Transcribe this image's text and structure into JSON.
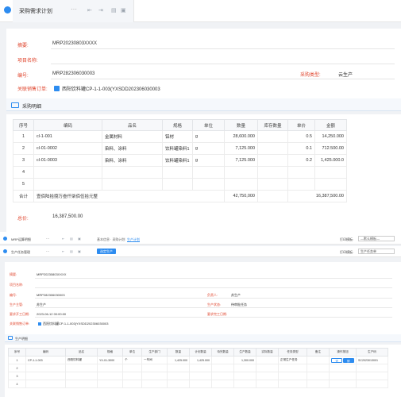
{
  "win1": {
    "tab_title": "采购需求计划",
    "tab_more": "···",
    "form": {
      "summary_label": "摘要:",
      "summary_value": "MRP20230803XXXX",
      "project_label": "项目名称:",
      "code_label": "编号:",
      "code_value": "MRP282306030003",
      "purchase_type_label": "采购类型:",
      "purchase_type_value": "云生产",
      "related_order_label": "关联销售订单:",
      "related_order_value": "西阳饮料罐CP-1-1-003(YXSDD202306030003"
    },
    "section_title": "采购明细",
    "table": {
      "headers": [
        "序号",
        "编码",
        "品名",
        "规格",
        "单位",
        "数量",
        "库存数量",
        "单价",
        "金额"
      ],
      "rows": [
        {
          "no": "1",
          "code": "cl-1-001",
          "name": "金属材料",
          "spec": "铝材",
          "unit": "g",
          "qty": "28,600.000",
          "stock": "",
          "price": "0.5",
          "amount": "14,250.000"
        },
        {
          "no": "2",
          "code": "cl-01-0002",
          "name": "染料、涂料",
          "spec": "饮料罐染料1",
          "unit": "g",
          "qty": "7,125.000",
          "stock": "",
          "price": "0.1",
          "amount": "712.500.00"
        },
        {
          "no": "3",
          "code": "cl-01-0003",
          "name": "染料、涂料",
          "spec": "饮料罐染料1",
          "unit": "g",
          "qty": "7,125.000",
          "stock": "",
          "price": "0.2",
          "amount": "1,425.000.0"
        },
        {
          "no": "4",
          "code": "",
          "name": "",
          "spec": "",
          "unit": "",
          "qty": "",
          "stock": "",
          "price": "",
          "amount": ""
        },
        {
          "no": "5",
          "code": "",
          "name": "",
          "spec": "",
          "unit": "",
          "qty": "",
          "stock": "",
          "price": "",
          "amount": ""
        }
      ],
      "total_label": "合计",
      "total_words": "壹佰陆拾捌万叁仟柒佰伍拾元整",
      "total_qty": "42,750,000",
      "total_amount": "16,387,500.00"
    },
    "total_label": "总价:",
    "total_value": "16,387,500.00"
  },
  "win2": {
    "top_title": "MRP运算明细",
    "top_more": "···",
    "top_info1": "基本信息 · 采购计划",
    "top_link": "生产计划",
    "top_right_label": "打印模板:",
    "top_right_value": "—默认模板—",
    "sub_title": "生产任务管理",
    "sub_more": "···",
    "sub_button": "选定生产",
    "sub_right_label": "打印模板:",
    "sub_right_value": "生产任务单",
    "form": {
      "summary_label": "摘要:",
      "summary_value": "MRP20230803XXXX",
      "project_label": "项目名称:",
      "code_label": "编号:",
      "code_value": "MRP282306030003",
      "owner_label": "负责人:",
      "owner_value": "苏生产",
      "produce_label": "生产主管:",
      "produce_value": "苏生产",
      "status_label": "生产状态:",
      "status_value": "待审批任务",
      "start_label": "要求开工日期:",
      "start_value": "2023-06-12 00:00:00",
      "finish_label": "要求完工日期:",
      "related_label": "关联销售订单:",
      "related_value": "西阳饮料罐CP-1-1-003(YXSDD202306030003"
    },
    "section_title": "生产明细",
    "table": {
      "headers": [
        "序号",
        "编码",
        "品名",
        "规格",
        "单位",
        "生产部门",
        "数量",
        "计划数量",
        "待完数量",
        "生产数量",
        "实际数量",
        "任务类型",
        "备注",
        "操作按钮",
        "生产码"
      ],
      "rows": [
        {
          "no": "1",
          "code": "CP-1-1-003",
          "name": "西阳饮料罐",
          "spec": "YX-01-3000",
          "unit": "个",
          "dept": "一车间",
          "qty": "1,425.000",
          "plan": "1,425.000",
          "pending": "",
          "produce": "1,300.000",
          "actual": "",
          "type": "正常生产任务",
          "note": "",
          "btn1": "查",
          "btn2": "修",
          "mcode": "SC2023013001"
        },
        {
          "no": "2",
          "code": "",
          "name": "",
          "spec": "",
          "unit": "",
          "dept": "",
          "qty": "",
          "plan": "",
          "pending": "",
          "produce": "",
          "actual": "",
          "type": "",
          "note": "",
          "btn1": "",
          "btn2": "",
          "mcode": ""
        },
        {
          "no": "3",
          "code": "",
          "name": "",
          "spec": "",
          "unit": "",
          "dept": "",
          "qty": "",
          "plan": "",
          "pending": "",
          "produce": "",
          "actual": "",
          "type": "",
          "note": "",
          "btn1": "",
          "btn2": "",
          "mcode": ""
        },
        {
          "no": "4",
          "code": "",
          "name": "",
          "spec": "",
          "unit": "",
          "dept": "",
          "qty": "",
          "plan": "",
          "pending": "",
          "produce": "",
          "actual": "",
          "type": "",
          "note": "",
          "btn1": "",
          "btn2": "",
          "mcode": ""
        }
      ]
    }
  },
  "colors": {
    "accent": "#2d8cf0",
    "label_red": "#e0472f",
    "page_bg": "#f0f2f5"
  },
  "icons": [
    "back-icon",
    "forward-icon",
    "print-icon",
    "refresh-icon",
    "save-icon",
    "table-icon",
    "checkbox-icon"
  ]
}
